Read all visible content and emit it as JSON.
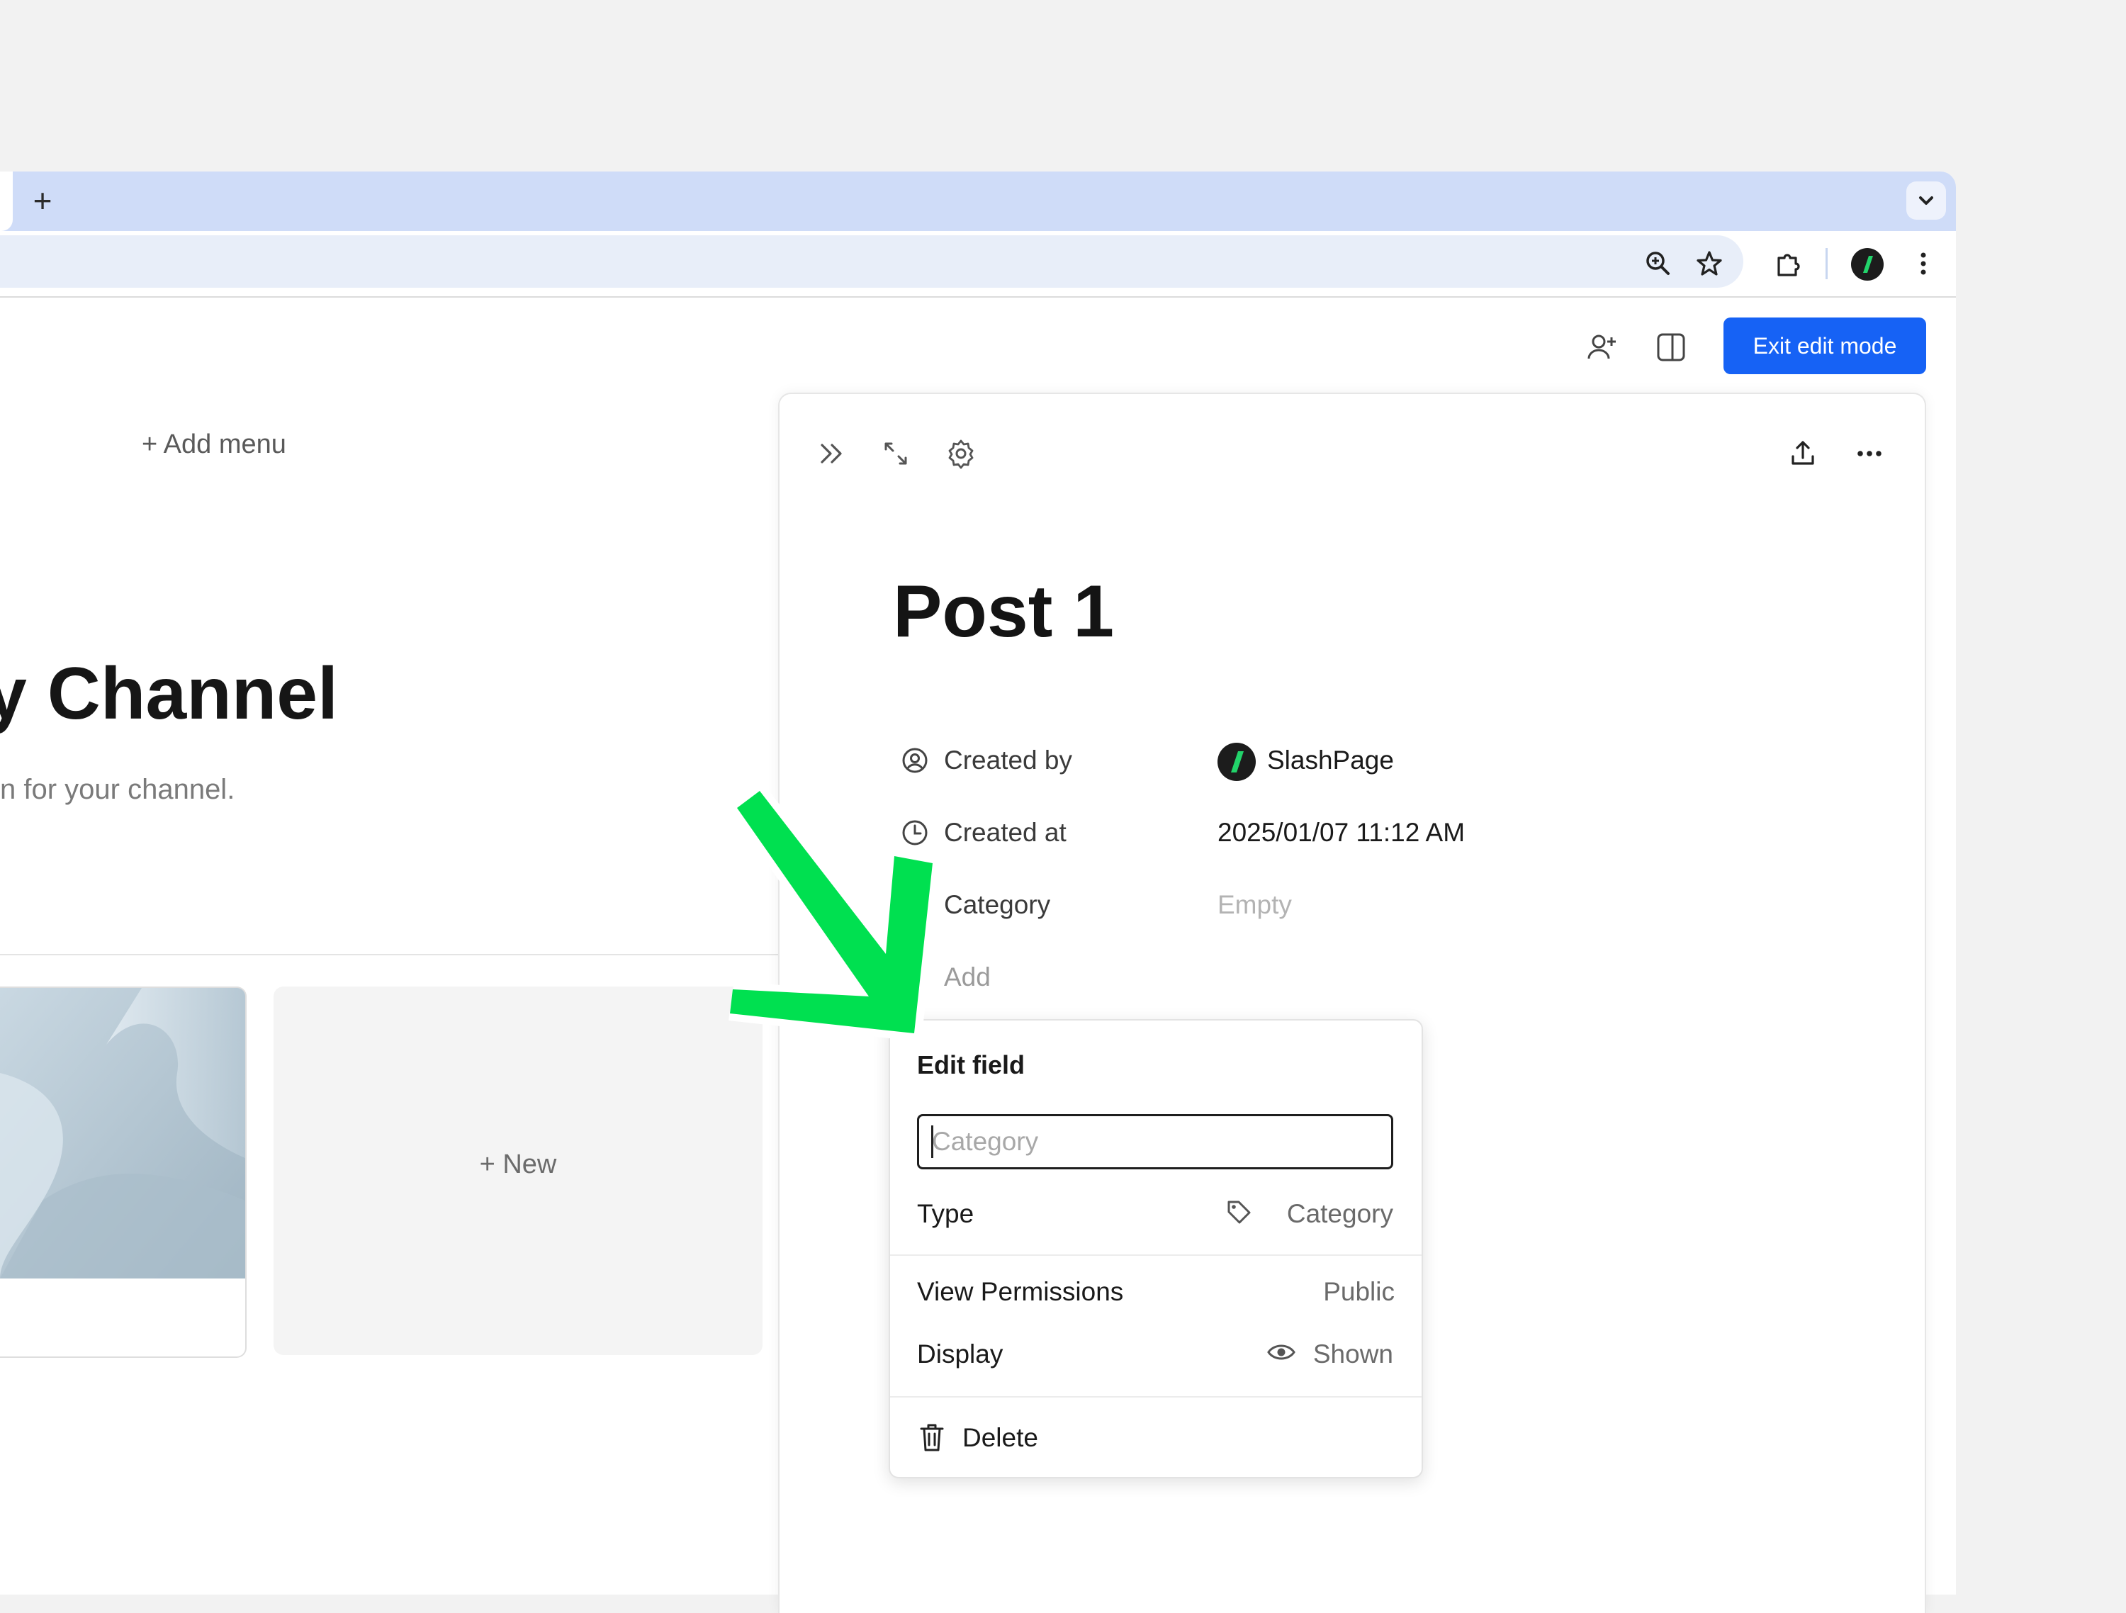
{
  "browser": {
    "new_tab": "+",
    "icons": [
      "zoom-icon",
      "bookmark-star-icon",
      "extensions-icon",
      "profile-avatar",
      "menu-kebab-icon"
    ]
  },
  "appbar": {
    "exit_edit_mode": "Exit edit mode",
    "icons": [
      "invite-user-icon",
      "split-view-icon"
    ]
  },
  "channel": {
    "add_menu": "Add menu",
    "title": "Channel",
    "title_prefix": "y",
    "subtitle": "n for your channel.",
    "new_card": "New"
  },
  "panel": {
    "post_title": "Post 1",
    "properties": [
      {
        "label": "Created by",
        "value": "SlashPage"
      },
      {
        "label": "Created at",
        "value": "2025/01/07 11:12 AM"
      },
      {
        "label": "Category",
        "value": "Empty"
      }
    ],
    "add_label": "Add"
  },
  "edit_field": {
    "title": "Edit field",
    "input_placeholder": "Category",
    "input_value": "",
    "type_label": "Type",
    "type_value": "Category",
    "view_permissions_label": "View Permissions",
    "view_permissions_value": "Public",
    "display_label": "Display",
    "display_value": "Shown",
    "delete_label": "Delete"
  },
  "colors": {
    "accent": "#1662f5",
    "tabstrip": "#cfdcf8",
    "annotation_arrow": "#00e050",
    "brand_green": "#22d36a"
  }
}
